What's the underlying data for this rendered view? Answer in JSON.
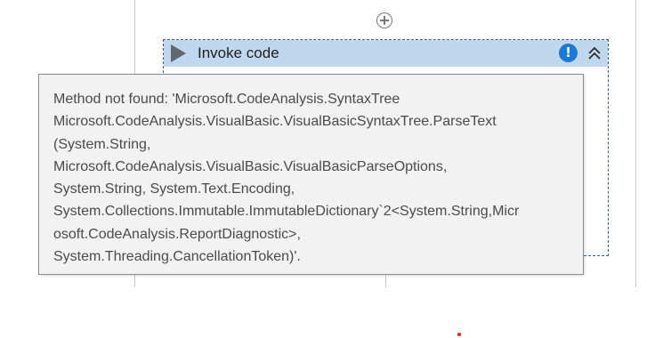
{
  "activity": {
    "title": "Invoke code"
  },
  "tooltip": {
    "lines": [
      "Method not found: 'Microsoft.CodeAnalysis.SyntaxTree",
      "Microsoft.CodeAnalysis.VisualBasic.VisualBasicSyntaxTree.ParseText",
      "(System.String,",
      "Microsoft.CodeAnalysis.VisualBasic.VisualBasicParseOptions,",
      "System.String, System.Text.Encoding,",
      "System.Collections.Immutable.ImmutableDictionary`2<System.String,Micr",
      "osoft.CodeAnalysis.ReportDiagnostic>,",
      "System.Threading.CancellationToken)'."
    ]
  },
  "icons": {
    "add": "plus-circle-icon",
    "play": "play-icon",
    "warning": "exclamation-icon",
    "collapse": "chevron-double-up-icon"
  },
  "colors": {
    "header_bg": "#c0d8ee",
    "warning": "#1a7ad4",
    "tooltip_bg": "#f2f2f2",
    "tooltip_text": "#4a4a4a"
  }
}
